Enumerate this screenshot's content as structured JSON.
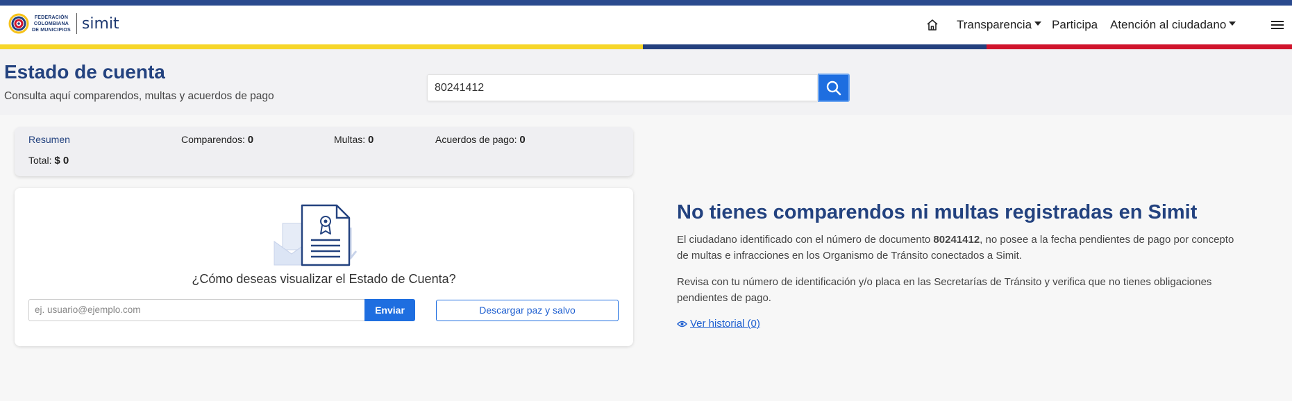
{
  "header": {
    "logo_org": [
      "FEDERACIÓN",
      "COLOMBIANA",
      "DE MUNICIPIOS"
    ],
    "logo_brand": "simit",
    "nav": {
      "home_icon": "home-icon",
      "transparencia": "Transparencia",
      "participa": "Participa",
      "atencion": "Atención al ciudadano",
      "menu_icon": "hamburger-menu-icon"
    }
  },
  "hero": {
    "title": "Estado de cuenta",
    "subtitle": "Consulta aquí comparendos, multas y acuerdos de pago",
    "search_value": "80241412",
    "search_icon": "search-icon"
  },
  "summary": {
    "resumen": "Resumen",
    "comparendos_label": "Comparendos:",
    "comparendos_value": "0",
    "multas_label": "Multas:",
    "multas_value": "0",
    "acuerdos_label": "Acuerdos de pago:",
    "acuerdos_value": "0",
    "total_label": "Total:",
    "total_value": "$ 0"
  },
  "card": {
    "illustration_icon": "certificate-document-icon",
    "question": "¿Cómo deseas visualizar el Estado de Cuenta?",
    "email_placeholder": "ej. usuario@ejemplo.com",
    "send_label": "Enviar",
    "download_label": "Descargar paz y salvo"
  },
  "result": {
    "title": "No tienes comparendos ni multas registradas en Simit",
    "p1_before": "El ciudadano identificado con el número de documento ",
    "p1_doc": "80241412",
    "p1_after": ", no posee a la fecha pendientes de pago por concepto de multas e infracciones en los Organismo de Tránsito conectados a Simit.",
    "p2": "Revisa con tu número de identificación y/o placa en las Secretarías de Tránsito y verifica que no tienes obligaciones pendientes de pago.",
    "history_label": "Ver historial (0)",
    "history_icon": "eye-icon"
  },
  "colors": {
    "primary": "#1e6ee0",
    "title_blue": "#23427f",
    "flag_yellow": "#f6d62a",
    "flag_blue": "#24407e",
    "flag_red": "#d0142c"
  }
}
